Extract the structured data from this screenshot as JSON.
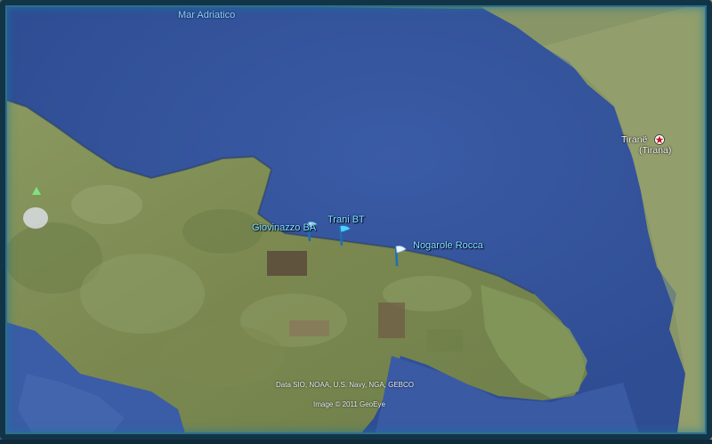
{
  "labels": {
    "sea": "Mar Adriatico",
    "capital_line1": "Tiranë",
    "capital_line2": "(Tirana)"
  },
  "placemarks": [
    {
      "name": "Giovinazzo BA",
      "icon": "flag-pin-icon"
    },
    {
      "name": "Trani BT",
      "icon": "flag-pin-icon"
    },
    {
      "name": "Nogarole Rocca",
      "icon": "flag-pin-icon"
    }
  ],
  "credits": {
    "data": "Data SIO, NOAA, U.S. Navy, NGA, GEBCO",
    "image": "Image © 2011 GeoEye"
  },
  "icons": {
    "capital": "star-icon",
    "peak": "triangle-icon"
  },
  "colors": {
    "sea": "#3d5fa8",
    "land": "#7f8c53",
    "label": "#7fe3ff",
    "frame": "#2e6f8c"
  }
}
